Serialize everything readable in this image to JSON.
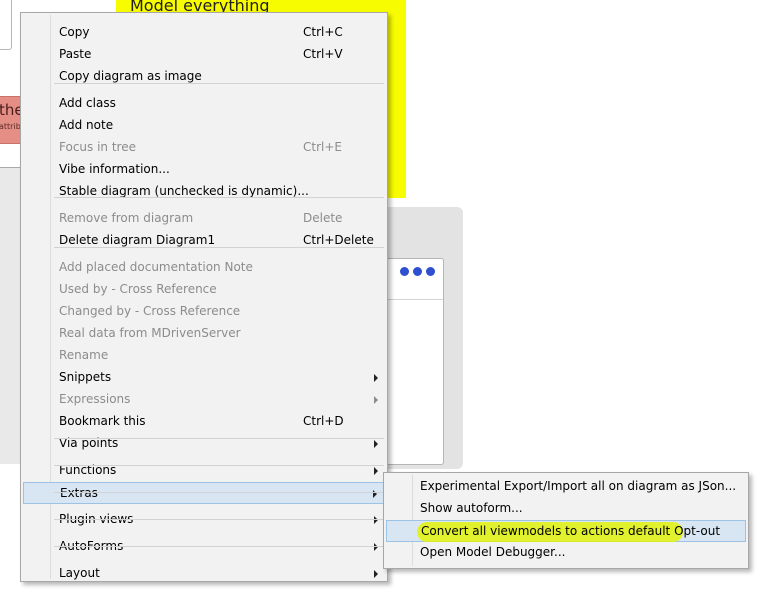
{
  "background": {
    "note_text": "Model everything",
    "class_name": "the",
    "class_attr": "attribut"
  },
  "menu": {
    "items": [
      {
        "label": "Copy",
        "shortcut": "Ctrl+C"
      },
      {
        "label": "Paste",
        "shortcut": "Ctrl+V"
      },
      {
        "label": "Copy diagram as image"
      },
      {
        "label": "Add class"
      },
      {
        "label": "Add note"
      },
      {
        "label": "Focus in tree",
        "shortcut": "Ctrl+E",
        "disabled": true
      },
      {
        "label": "Vibe information..."
      },
      {
        "label": "Stable diagram (unchecked is dynamic)..."
      },
      {
        "label": "Remove from diagram",
        "shortcut": "Delete",
        "disabled": true
      },
      {
        "label": "Delete diagram Diagram1",
        "shortcut": "Ctrl+Delete"
      },
      {
        "label": "Add placed documentation Note",
        "disabled": true
      },
      {
        "label": "Used by - Cross Reference",
        "disabled": true
      },
      {
        "label": "Changed by - Cross Reference",
        "disabled": true
      },
      {
        "label": "Real data from MDrivenServer",
        "disabled": true
      },
      {
        "label": "Rename",
        "disabled": true
      },
      {
        "label": "Snippets",
        "submenu": true
      },
      {
        "label": "Expressions",
        "submenu": true,
        "disabled": true
      },
      {
        "label": "Bookmark this",
        "shortcut": "Ctrl+D"
      },
      {
        "label": "Via points",
        "submenu": true
      },
      {
        "label": "Functions",
        "submenu": true
      },
      {
        "label": "Extras",
        "submenu": true,
        "hover": true
      },
      {
        "label": "Plugin views",
        "submenu": true
      },
      {
        "label": "AutoForms",
        "submenu": true
      },
      {
        "label": "Layout",
        "submenu": true
      }
    ]
  },
  "submenu": {
    "items": [
      {
        "label": "Experimental Export/Import all on diagram as JSon..."
      },
      {
        "label": "Show autoform..."
      },
      {
        "label": "Convert all viewmodels to actions default Opt-out",
        "hover": true,
        "highlighted": true
      },
      {
        "label": "Open Model Debugger..."
      }
    ]
  },
  "colors": {
    "note_yellow": "#f8fc00",
    "highlighter": "#e4f20a",
    "hover_bg": "#d8e6f3",
    "hover_border": "#9cc3e3",
    "dot_blue": "#2d4fd0",
    "class_fill": "#e58e86"
  }
}
